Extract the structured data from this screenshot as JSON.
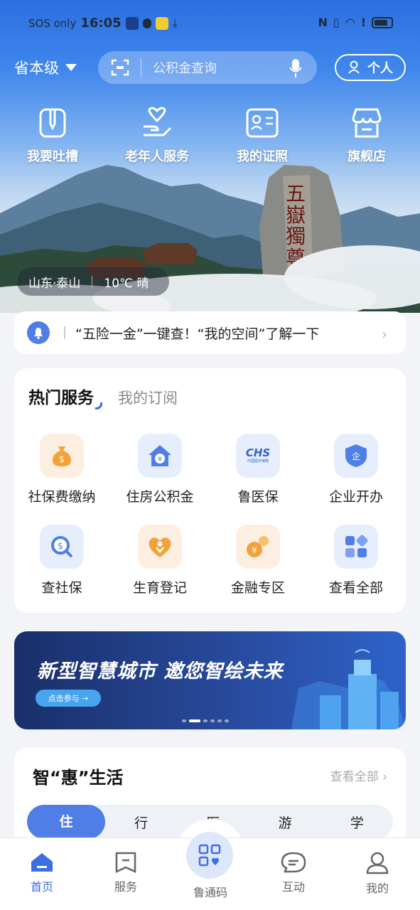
{
  "status_bar": {
    "carrier": "SOS only",
    "time": "16:05"
  },
  "header": {
    "region": "省本级",
    "search_placeholder": "公积金查询",
    "personal_label": "个人"
  },
  "quick_links": [
    {
      "label": "我要吐槽",
      "icon": "phone-edit-icon"
    },
    {
      "label": "老年人服务",
      "icon": "heart-hand-icon"
    },
    {
      "label": "我的证照",
      "icon": "id-card-icon"
    },
    {
      "label": "旗舰店",
      "icon": "store-icon"
    }
  ],
  "weather": {
    "location": "山东·泰山",
    "condition": "10℃ 晴"
  },
  "notice": {
    "text": "“五险一金”一键查！“我的空间”了解一下"
  },
  "hot_services": {
    "tab_active": "热门服务",
    "tab_other": "我的订阅",
    "items": [
      {
        "label": "社保费缴纳",
        "icon": "money-bag-icon",
        "color": "#f2a23a"
      },
      {
        "label": "住房公积金",
        "icon": "house-yuan-icon",
        "color": "#4f7ee6"
      },
      {
        "label": "鲁医保",
        "icon": "chs-logo-icon",
        "color": "#2f63c8"
      },
      {
        "label": "企业开办",
        "icon": "enterprise-shield-icon",
        "color": "#4f7ee6"
      },
      {
        "label": "查社保",
        "icon": "search-social-icon",
        "color": "#4f7ee6"
      },
      {
        "label": "生育登记",
        "icon": "heart-baby-icon",
        "color": "#f2a23a"
      },
      {
        "label": "金融专区",
        "icon": "coins-icon",
        "color": "#f2a23a"
      },
      {
        "label": "查看全部",
        "icon": "grid-all-icon",
        "color": "#4f7ee6"
      }
    ],
    "chs_text": "CHS",
    "chs_sub": "中国医疗保障"
  },
  "banner": {
    "title": "新型智慧城市 邀您智绘未来",
    "button": "点击参与 →"
  },
  "life": {
    "title": "智“惠”生活",
    "view_all": "查看全部",
    "categories": [
      "住",
      "行",
      "医",
      "游",
      "学"
    ]
  },
  "bottom_nav": [
    {
      "label": "首页",
      "icon": "home-icon"
    },
    {
      "label": "服务",
      "icon": "bookmark-icon"
    },
    {
      "label": "鲁通码",
      "icon": "code-icon"
    },
    {
      "label": "互动",
      "icon": "chat-icon"
    },
    {
      "label": "我的",
      "icon": "user-icon"
    }
  ],
  "colors": {
    "accent": "#4f7ee6",
    "orange": "#f2a23a"
  }
}
